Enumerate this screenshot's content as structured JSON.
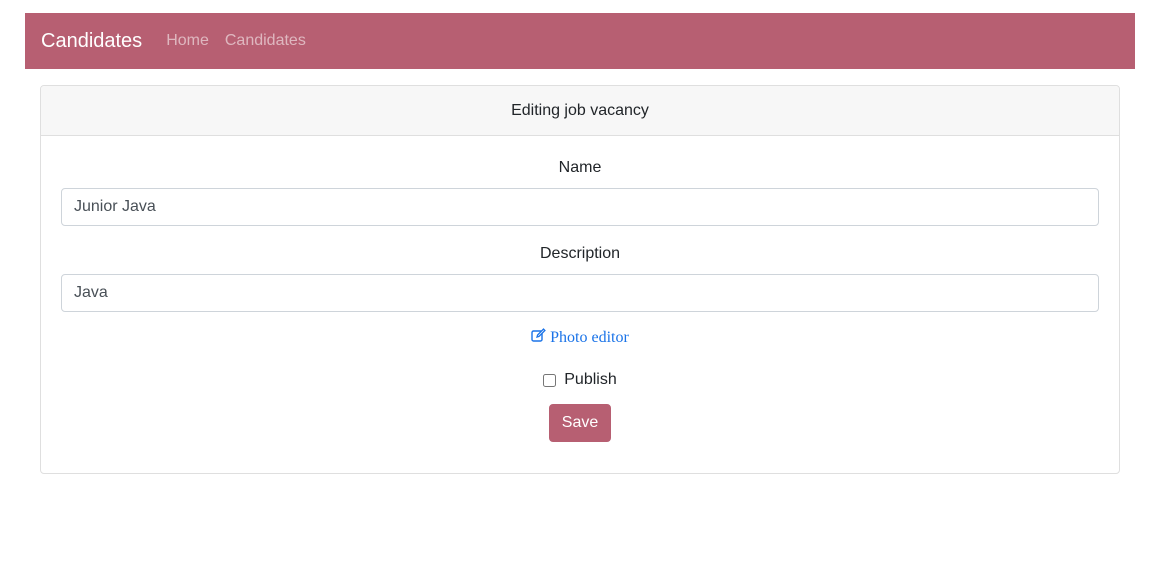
{
  "navbar": {
    "brand": "Candidates",
    "links": [
      "Home",
      "Candidates"
    ],
    "color": "#b75f72"
  },
  "card": {
    "header": "Editing job vacancy"
  },
  "form": {
    "name_label": "Name",
    "name_value": "Junior Java",
    "description_label": "Description",
    "description_value": "Java",
    "photo_link_label": "Photo editor",
    "photo_link_icon": "edit-icon",
    "publish_label": "Publish",
    "publish_checked": false,
    "save_label": "Save"
  }
}
